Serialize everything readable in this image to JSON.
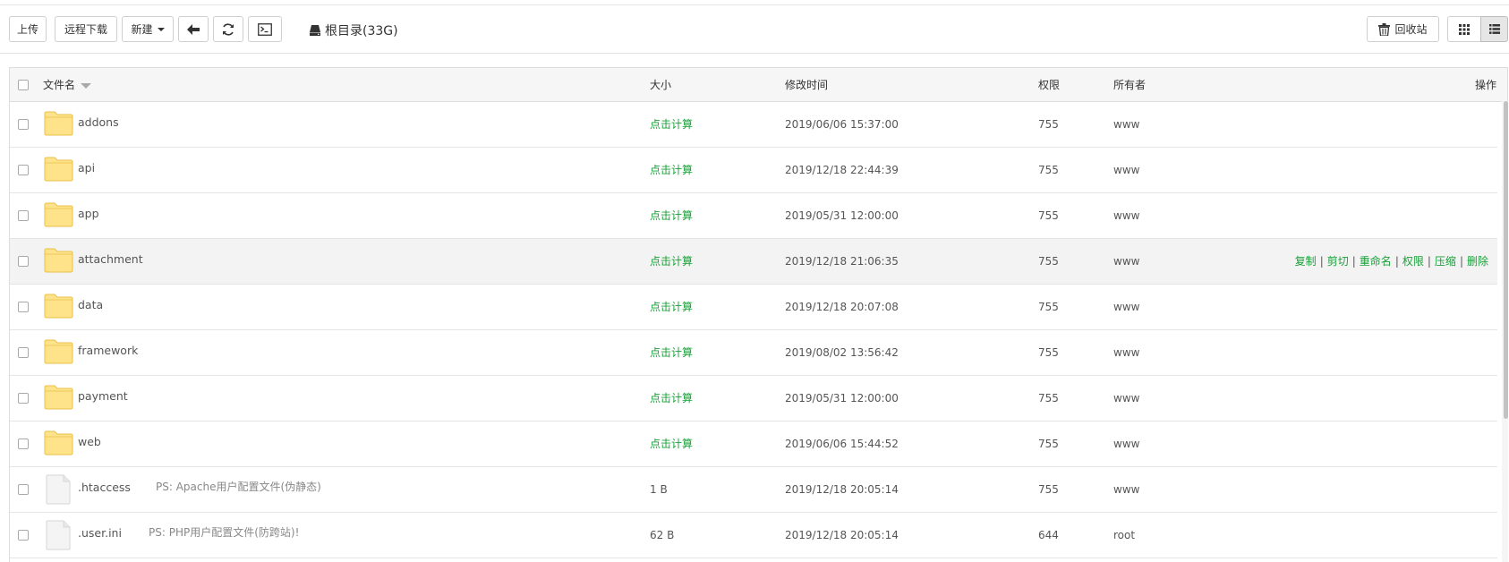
{
  "toolbar": {
    "upload": "上传",
    "remote_download": "远程下载",
    "new": "新建",
    "path_label": "根目录(33G)",
    "recycle_bin": "回收站"
  },
  "table": {
    "headers": {
      "name": "文件名",
      "size": "大小",
      "mtime": "修改时间",
      "perm": "权限",
      "owner": "所有者",
      "ops": "操作"
    },
    "rows": [
      {
        "type": "folder",
        "name": "addons",
        "ps": "",
        "size": "点击计算",
        "mtime": "2019/06/06 15:37:00",
        "perm": "755",
        "owner": "www"
      },
      {
        "type": "folder",
        "name": "api",
        "ps": "",
        "size": "点击计算",
        "mtime": "2019/12/18 22:44:39",
        "perm": "755",
        "owner": "www"
      },
      {
        "type": "folder",
        "name": "app",
        "ps": "",
        "size": "点击计算",
        "mtime": "2019/05/31 12:00:00",
        "perm": "755",
        "owner": "www"
      },
      {
        "type": "folder",
        "name": "attachment",
        "ps": "",
        "size": "点击计算",
        "mtime": "2019/12/18 21:06:35",
        "perm": "755",
        "owner": "www",
        "hover": true
      },
      {
        "type": "folder",
        "name": "data",
        "ps": "",
        "size": "点击计算",
        "mtime": "2019/12/18 20:07:08",
        "perm": "755",
        "owner": "www"
      },
      {
        "type": "folder",
        "name": "framework",
        "ps": "",
        "size": "点击计算",
        "mtime": "2019/08/02 13:56:42",
        "perm": "755",
        "owner": "www"
      },
      {
        "type": "folder",
        "name": "payment",
        "ps": "",
        "size": "点击计算",
        "mtime": "2019/05/31 12:00:00",
        "perm": "755",
        "owner": "www"
      },
      {
        "type": "folder",
        "name": "web",
        "ps": "",
        "size": "点击计算",
        "mtime": "2019/06/06 15:44:52",
        "perm": "755",
        "owner": "www"
      },
      {
        "type": "file",
        "name": ".htaccess",
        "ps": "PS: Apache用户配置文件(伪静态)",
        "size": "1 B",
        "mtime": "2019/12/18 20:05:14",
        "perm": "755",
        "owner": "www"
      },
      {
        "type": "file",
        "name": ".user.ini",
        "ps": "PS: PHP用户配置文件(防跨站)!",
        "size": "62 B",
        "mtime": "2019/12/18 20:05:14",
        "perm": "644",
        "owner": "root"
      }
    ],
    "row_ops": [
      "复制",
      "剪切",
      "重命名",
      "权限",
      "压缩",
      "删除"
    ]
  },
  "colors": {
    "accent_green": "#1aa03a",
    "folder_yellow": "#ffe38a"
  }
}
